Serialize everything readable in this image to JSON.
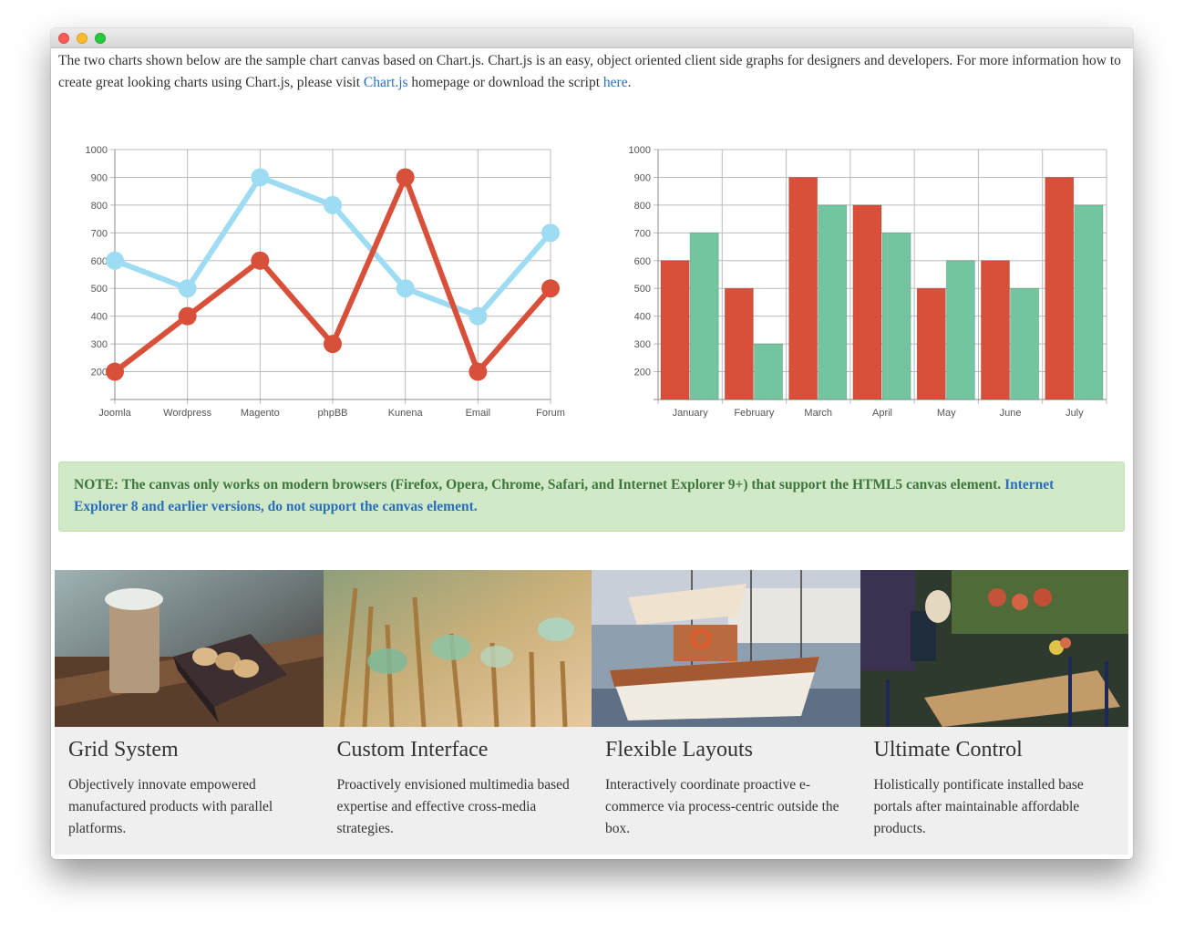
{
  "intro": {
    "text_before_link": "The two charts shown below are the sample chart canvas based on Chart.js. Chart.js is an easy, object oriented client side graphs for designers and developers. For more information how to create great looking charts using Chart.js, please visit ",
    "link1": "Chart.js",
    "text_middle": " homepage or download the script ",
    "link2": "here",
    "text_end": "."
  },
  "note": {
    "text": "NOTE: The canvas only works on modern browsers (Firefox, Opera, Chrome, Safari, and Internet Explorer 9+) that support the HTML5 canvas element. ",
    "link": "Internet Explorer 8 and earlier versions, do not support the canvas element."
  },
  "features": [
    {
      "title": "Grid System",
      "text": "Objectively innovate empowered manufactured products with parallel platforms."
    },
    {
      "title": "Custom Interface",
      "text": "Proactively envisioned multimedia based expertise and effective cross-media strategies."
    },
    {
      "title": "Flexible Layouts",
      "text": "Interactively coordinate proactive e-commerce via process-centric outside the box."
    },
    {
      "title": "Ultimate Control",
      "text": "Holistically pontificate installed base portals after maintainable affordable products."
    }
  ],
  "colors": {
    "series_red": "#d9503a",
    "series_blue": "#9ddcf2",
    "series_green": "#73c5a0",
    "note_bg": "#d2e9c8",
    "note_text": "#3c763d",
    "link": "#2a6ebb"
  },
  "chart_data": [
    {
      "type": "line",
      "categories": [
        "Joomla",
        "Wordpress",
        "Magento",
        "phpBB",
        "Kunena",
        "Email",
        "Forum"
      ],
      "series": [
        {
          "values": [
            600,
            500,
            900,
            800,
            500,
            400,
            700
          ]
        },
        {
          "values": [
            200,
            400,
            600,
            300,
            900,
            200,
            500
          ]
        }
      ],
      "yticks": [
        200,
        300,
        400,
        500,
        600,
        700,
        800,
        900,
        1000
      ],
      "ylim": [
        100,
        1000
      ],
      "grid": true
    },
    {
      "type": "bar",
      "categories": [
        "January",
        "February",
        "March",
        "April",
        "May",
        "June",
        "July"
      ],
      "series": [
        {
          "values": [
            600,
            500,
            900,
            800,
            500,
            600,
            900
          ]
        },
        {
          "values": [
            700,
            300,
            800,
            700,
            600,
            500,
            800
          ]
        }
      ],
      "yticks": [
        200,
        300,
        400,
        500,
        600,
        700,
        800,
        900,
        1000
      ],
      "ylim": [
        100,
        1000
      ],
      "grid": true
    }
  ]
}
